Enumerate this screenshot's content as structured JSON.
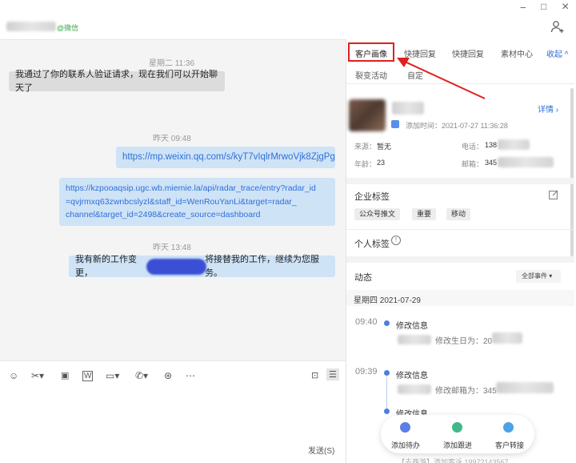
{
  "header": {
    "contact_tag": "@微信"
  },
  "window": {
    "minimize": "−",
    "maximize": "□",
    "close": "×"
  },
  "chat": {
    "messages": [
      {
        "time": "星期二 11:36",
        "text": "我通过了你的联系人验证请求，现在我们可以开始聊天了",
        "side": "left"
      },
      {
        "time": "昨天 09:48",
        "text": "https://mp.weixin.qq.com/s/kyT7vIqlrMrwoVjk8ZjgPg",
        "side": "right"
      },
      {
        "text": "https://kzpooaqsip.ugc.wb.miemie.la/api/radar_trace/entry?radar_id\n=qvjrmxq63zwnbcslyzl&staff_id=WenRouYanLi&target=radar_\nchannel&target_id=2498&create_source=dashboard",
        "side": "right"
      },
      {
        "time": "昨天 13:48",
        "text_a": "我有新的工作变更，",
        "text_b": "将接替我的工作，继续为您服务。",
        "side": "right"
      }
    ],
    "send": "发送(S)"
  },
  "panel": {
    "tabs": [
      "客户画像",
      "快捷回复",
      "快捷回复",
      "素材中心",
      "收起"
    ],
    "tabs2": [
      "裂变活动",
      "自定"
    ],
    "detail": "详情",
    "add_time": "添加时间：2021-07-27 11:36:28",
    "source_label": "来源：",
    "source_value": "暂无",
    "age_label": "年龄：",
    "age_value": "23",
    "phone_label": "电话：",
    "phone_value": "138",
    "email_label": "邮箱：",
    "email_value": "345",
    "corp_tags_title": "企业标签",
    "corp_tags": [
      "公众号推文",
      "重要",
      "移动"
    ],
    "personal_tags_title": "个人标签",
    "dynamics_title": "动态",
    "dynamics_filter": "全部事件",
    "date": "星期四 2021-07-29",
    "events": [
      {
        "time": "09:40",
        "title": "修改信息",
        "detail": "修改生日为：20"
      },
      {
        "time": "09:39",
        "title": "修改信息",
        "detail": "修改邮箱为：345"
      },
      {
        "time": "",
        "title": "修改信息",
        "detail": ""
      }
    ],
    "actions": [
      "添加待办",
      "添加跟进",
      "客户转接"
    ],
    "bottom_partial": "【去西游】添加客诉 19972143567"
  }
}
